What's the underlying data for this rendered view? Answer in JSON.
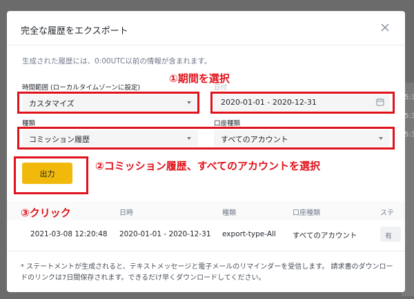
{
  "background": {
    "side_char": "5:3"
  },
  "modal": {
    "title": "完全な履歴をエクスポート",
    "info": "生成された履歴には、0:00UTC以前の情報が含まれます。",
    "time_range": {
      "label": "時間範囲 (ローカルタイムゾーンに設定)",
      "value": "カスタマイズ"
    },
    "date_label_partial": "日付",
    "date_range": {
      "value": "2020-01-01 - 2020-12-31"
    },
    "type": {
      "label": "種類",
      "value": "コミッション履歴"
    },
    "account_type": {
      "label": "口座種類",
      "value": "すべてのアカウント"
    },
    "export_label": "出力",
    "table": {
      "headers": [
        "日時",
        "種類",
        "口座種類",
        "ステ"
      ],
      "row": {
        "created": "2021-03-08 12:20:48",
        "range": "2020-01-01 - 2020-12-31",
        "type": "export-type-All",
        "account": "すべてのアカウント",
        "status": "有"
      }
    },
    "note": "* ステートメントが生成されると、テキストメッセージと電子メールのリマインダーを受信します。 請求書のダウンロードのリンクは7日間保存されます。できるだけ早くダウンロードしてください。"
  },
  "annotations": {
    "step1": "①期間を選択",
    "step2": "②コミッション履歴、すべてのアカウントを選択",
    "step3": "③クリック"
  },
  "colors": {
    "accent": "#f0b90b",
    "annotation": "#e0111a"
  }
}
